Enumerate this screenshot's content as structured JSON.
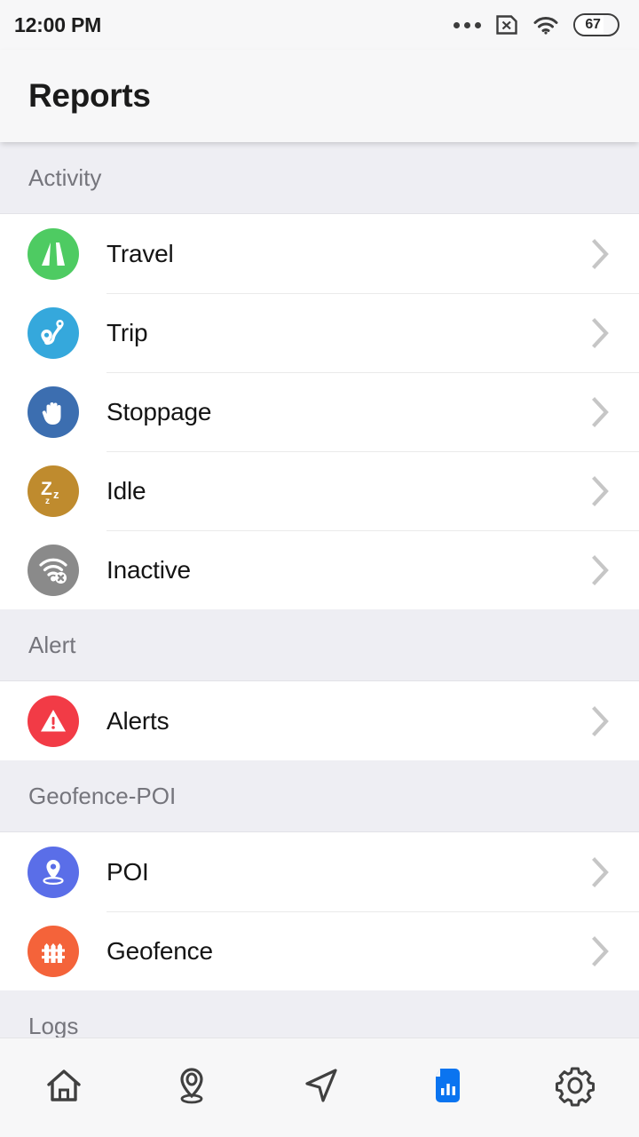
{
  "status_bar": {
    "time": "12:00 PM",
    "icons": [
      "more-dots-icon",
      "sim-card-off-icon",
      "wifi-icon",
      "battery-icon"
    ],
    "battery_level": "67"
  },
  "app_bar": {
    "title": "Reports"
  },
  "colors": {
    "accent": "#0a74f0",
    "travel": "#4ecb62",
    "trip": "#35a8dc",
    "stoppage": "#3c6eb0",
    "idle": "#bf8b2e",
    "inactive": "#8a8a8a",
    "alerts": "#f23b46",
    "poi": "#5a6ee8",
    "geofence": "#f4633a",
    "section_bg": "#eeeef3",
    "row_bg": "#ffffff",
    "chevron": "#c6c6c6",
    "nav_icon": "#404040"
  },
  "sections": [
    {
      "title": "Activity",
      "items": [
        {
          "label": "Travel",
          "icon": "road-icon",
          "color_key": "travel"
        },
        {
          "label": "Trip",
          "icon": "route-pins-icon",
          "color_key": "trip"
        },
        {
          "label": "Stoppage",
          "icon": "hand-stop-icon",
          "color_key": "stoppage"
        },
        {
          "label": "Idle",
          "icon": "sleep-zzz-icon",
          "color_key": "idle"
        },
        {
          "label": "Inactive",
          "icon": "wifi-off-icon",
          "color_key": "inactive"
        }
      ]
    },
    {
      "title": "Alert",
      "items": [
        {
          "label": "Alerts",
          "icon": "warning-triangle-icon",
          "color_key": "alerts"
        }
      ]
    },
    {
      "title": "Geofence-POI",
      "items": [
        {
          "label": "POI",
          "icon": "map-pin-icon",
          "color_key": "poi"
        },
        {
          "label": "Geofence",
          "icon": "fence-icon",
          "color_key": "geofence"
        }
      ]
    },
    {
      "title": "Logs",
      "items": []
    }
  ],
  "bottom_nav": {
    "items": [
      {
        "icon": "home-icon",
        "active": false
      },
      {
        "icon": "map-pin-icon",
        "active": false
      },
      {
        "icon": "navigation-arrow-icon",
        "active": false
      },
      {
        "icon": "reports-chart-document-icon",
        "active": true
      },
      {
        "icon": "gear-icon",
        "active": false
      }
    ]
  }
}
